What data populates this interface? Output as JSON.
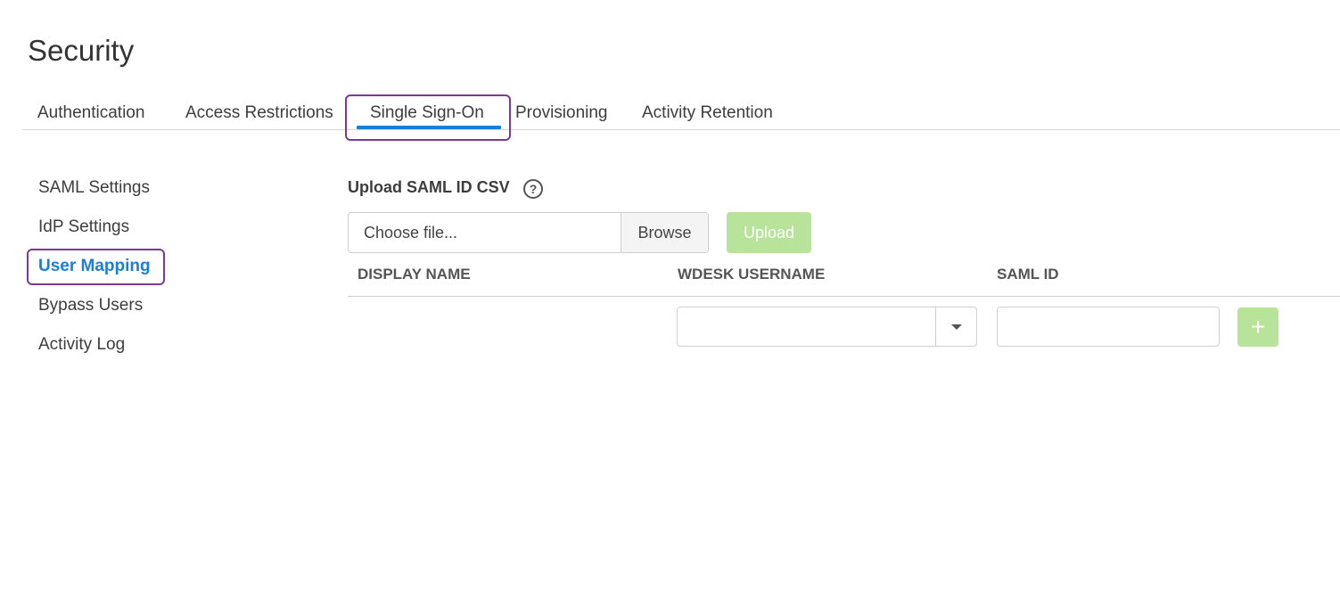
{
  "page": {
    "title": "Security"
  },
  "tabs": [
    {
      "label": "Authentication"
    },
    {
      "label": "Access Restrictions"
    },
    {
      "label": "Single Sign-On",
      "active": true
    },
    {
      "label": "Provisioning"
    },
    {
      "label": "Activity Retention"
    }
  ],
  "sidebar": {
    "items": [
      {
        "label": "SAML Settings"
      },
      {
        "label": "IdP Settings"
      },
      {
        "label": "User Mapping",
        "active": true
      },
      {
        "label": "Bypass Users"
      },
      {
        "label": "Activity Log"
      }
    ]
  },
  "upload": {
    "label": "Upload SAML ID CSV",
    "help_icon": "?",
    "file_placeholder": "Choose file...",
    "browse_label": "Browse",
    "upload_label": "Upload"
  },
  "table": {
    "columns": [
      "DISPLAY NAME",
      "WDESK USERNAME",
      "SAML ID"
    ],
    "new_row": {
      "username_value": "",
      "saml_id_value": "",
      "add_label": "+"
    }
  },
  "colors": {
    "accent": "#1a7fd6",
    "highlight": "#7b3a96",
    "disabled_green": "#b8e39a"
  }
}
